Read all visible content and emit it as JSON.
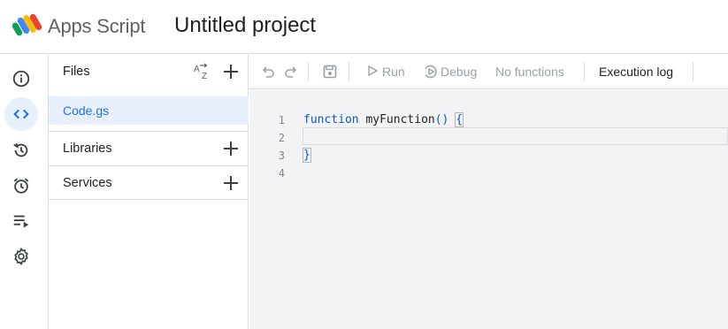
{
  "header": {
    "app_name": "Apps Script",
    "project_title": "Untitled project"
  },
  "rail": {
    "items": [
      {
        "icon": "info-icon",
        "active": false
      },
      {
        "icon": "code-icon",
        "active": true
      },
      {
        "icon": "history-icon",
        "active": false
      },
      {
        "icon": "alarm-icon",
        "active": false
      },
      {
        "icon": "executions-icon",
        "active": false
      },
      {
        "icon": "gear-icon",
        "active": false
      }
    ]
  },
  "files_panel": {
    "title": "Files",
    "files": [
      {
        "name": "Code.gs",
        "selected": true
      }
    ],
    "sections": [
      {
        "label": "Libraries"
      },
      {
        "label": "Services"
      }
    ]
  },
  "toolbar": {
    "run_label": "Run",
    "debug_label": "Debug",
    "function_select": "No functions",
    "execution_log_label": "Execution log"
  },
  "editor": {
    "line_numbers": [
      "1",
      "2",
      "3",
      "4"
    ],
    "keyword": "function",
    "function_name": "myFunction",
    "parens": "()",
    "open_brace": "{",
    "close_brace": "}"
  },
  "colors": {
    "accent": "#1a73e8",
    "selected_bg": "#e8f0fe",
    "editor_bg": "#f1f3f4",
    "keyword": "#0b57d0"
  }
}
